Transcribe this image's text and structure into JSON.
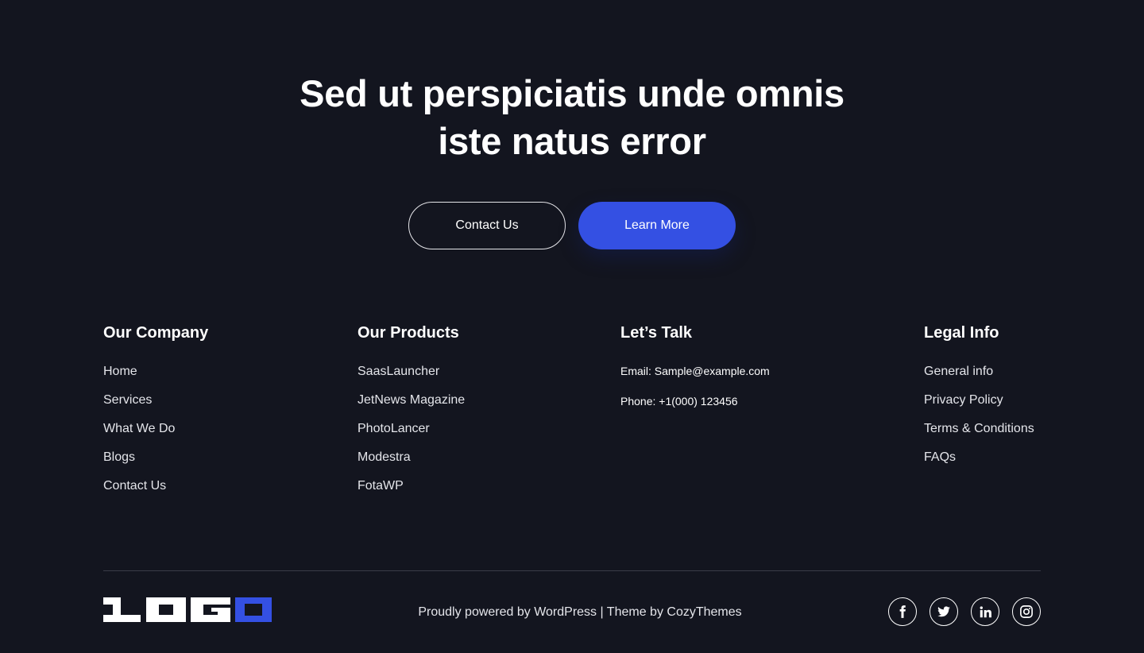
{
  "cta": {
    "heading_line1": "Sed ut perspiciatis unde omnis",
    "heading_line2": "iste natus error",
    "contact_label": "Contact Us",
    "learn_label": "Learn More"
  },
  "footer": {
    "company": {
      "title": "Our Company",
      "items": [
        "Home",
        "Services",
        "What We Do",
        "Blogs",
        "Contact Us"
      ]
    },
    "products": {
      "title": "Our Products",
      "items": [
        "SaasLauncher",
        "JetNews Magazine",
        "PhotoLancer",
        "Modestra",
        "FotaWP"
      ]
    },
    "talk": {
      "title": "Let’s Talk",
      "email": "Email: Sample@example.com",
      "phone": "Phone: +1(000) 123456"
    },
    "legal": {
      "title": "Legal Info",
      "items": [
        "General info",
        "Privacy Policy",
        "Terms & Conditions",
        "FAQs"
      ]
    },
    "logo_text": "LOGO",
    "credits": "Proudly powered by WordPress | Theme by CozyThemes",
    "socials": [
      "facebook-icon",
      "twitter-icon",
      "linkedin-icon",
      "instagram-icon"
    ]
  },
  "colors": {
    "background": "#13151f",
    "accent": "#3450e3",
    "text": "#ffffff"
  }
}
